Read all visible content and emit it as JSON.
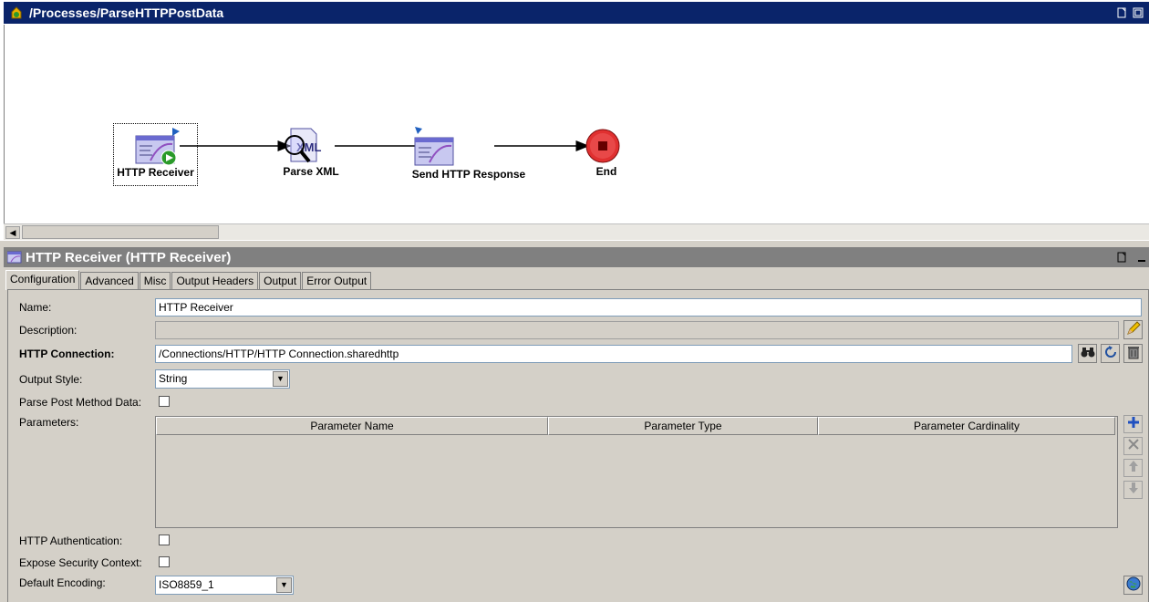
{
  "process": {
    "title": "/Processes/ParseHTTPPostData",
    "activities": [
      {
        "label": "HTTP Receiver"
      },
      {
        "label": "Parse XML"
      },
      {
        "label": "Send HTTP Response"
      },
      {
        "label": "End"
      }
    ]
  },
  "panel": {
    "title": "HTTP Receiver (HTTP Receiver)",
    "tabs": [
      "Configuration",
      "Advanced",
      "Misc",
      "Output Headers",
      "Output",
      "Error Output"
    ],
    "active_tab": "Configuration"
  },
  "form": {
    "name_label": "Name:",
    "name_value": "HTTP Receiver",
    "description_label": "Description:",
    "description_value": "",
    "connection_label": "HTTP Connection:",
    "connection_value": "/Connections/HTTP/HTTP Connection.sharedhttp",
    "output_style_label": "Output Style:",
    "output_style_value": "String",
    "parse_post_label": "Parse Post Method Data:",
    "parse_post_checked": false,
    "parameters_label": "Parameters:",
    "parameters_columns": [
      "Parameter Name",
      "Parameter Type",
      "Parameter Cardinality"
    ],
    "parameters_rows": [],
    "http_auth_label": "HTTP Authentication:",
    "http_auth_checked": false,
    "expose_security_label": "Expose Security Context:",
    "expose_security_checked": false,
    "default_encoding_label": "Default Encoding:",
    "default_encoding_value": "ISO8859_1"
  },
  "icons": {
    "process": "process-folder-icon",
    "receiver": "http-receiver-icon",
    "parse": "parse-xml-icon",
    "response": "send-http-response-icon",
    "end": "end-icon"
  },
  "colors": {
    "title_active": "#0a246a",
    "title_inactive": "#808080",
    "end_red": "#e03030"
  }
}
